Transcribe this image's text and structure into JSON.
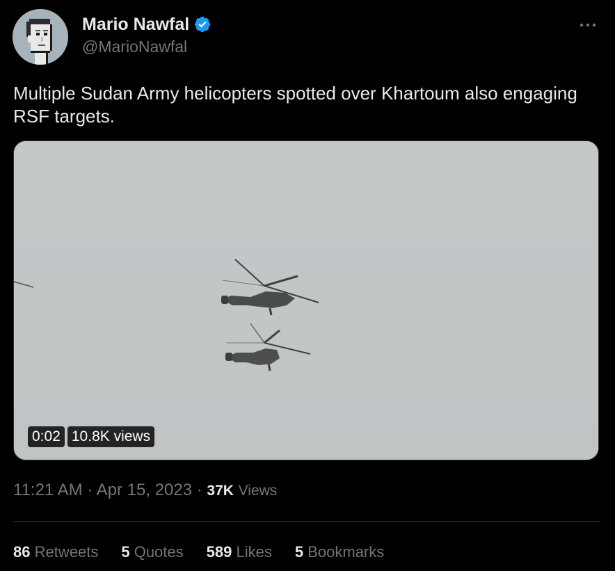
{
  "author": {
    "name": "Mario Nawfal",
    "handle": "@MarioNawfal",
    "verified": true,
    "avatar_icon": "pixel-art-avatar"
  },
  "icons": {
    "more": "more-options-icon",
    "verified": "verified-badge-icon"
  },
  "tweet": {
    "text": "Multiple Sudan Army helicopters spotted over Khartoum also engaging RSF targets."
  },
  "media": {
    "type": "video",
    "duration": "0:02",
    "views": "10.8K views"
  },
  "meta": {
    "time": "11:21 AM",
    "separator": "·",
    "date": "Apr 15, 2023",
    "views_count": "37K",
    "views_label": "Views"
  },
  "stats": [
    {
      "count": "86",
      "label": "Retweets"
    },
    {
      "count": "5",
      "label": "Quotes"
    },
    {
      "count": "589",
      "label": "Likes"
    },
    {
      "count": "5",
      "label": "Bookmarks"
    }
  ],
  "colors": {
    "background": "#000000",
    "text_primary": "#e7e9ea",
    "text_secondary": "#71767b",
    "verified_blue": "#1d9bf0",
    "divider": "#2f3336"
  }
}
